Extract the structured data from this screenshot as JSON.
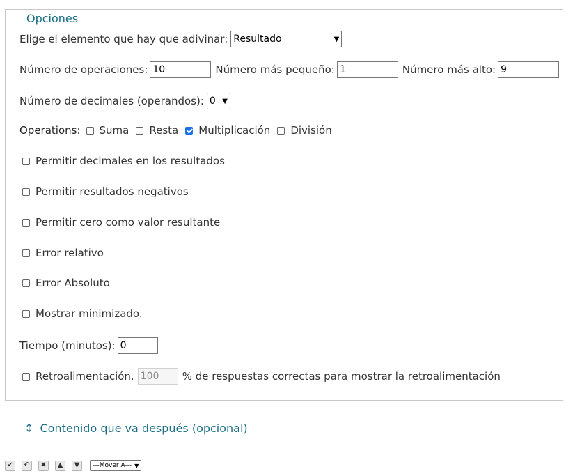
{
  "options": {
    "legend": "Opciones",
    "element_label": "Elige el elemento que hay que adivinar:",
    "element_value": "Resultado",
    "num_ops_label": "Número de operaciones:",
    "num_ops_value": "10",
    "min_label": "Número más pequeño:",
    "min_value": "1",
    "max_label": "Número más alto:",
    "max_value": "9",
    "decimals_label": "Número de decimales (operandos):",
    "decimals_value": "0",
    "operations_label": "Operations:",
    "operations": [
      {
        "label": "Suma",
        "checked": false
      },
      {
        "label": "Resta",
        "checked": false
      },
      {
        "label": "Multiplicación",
        "checked": true
      },
      {
        "label": "División",
        "checked": false
      }
    ],
    "checkboxes": [
      {
        "label": "Permitir decimales en los resultados",
        "checked": false
      },
      {
        "label": "Permitir resultados negativos",
        "checked": false
      },
      {
        "label": "Permitir cero como valor resultante",
        "checked": false
      },
      {
        "label": "Error relativo",
        "checked": false
      },
      {
        "label": "Error Absoluto",
        "checked": false
      },
      {
        "label": "Mostrar minimizado.",
        "checked": false
      }
    ],
    "time_label": "Tiempo (minutos):",
    "time_value": "0",
    "feedback_label": "Retroalimentación.",
    "feedback_value": "100",
    "feedback_suffix": "% de respuestas correctas para mostrar la retroalimentación"
  },
  "after_section": {
    "arrow": "↕",
    "title": "Contenido que va después (opcional)"
  },
  "toolbar": {
    "mover_label": "---Mover A---"
  },
  "colors": {
    "accent": "#1a6e86",
    "checkbox_checked": "#1a73e8"
  }
}
